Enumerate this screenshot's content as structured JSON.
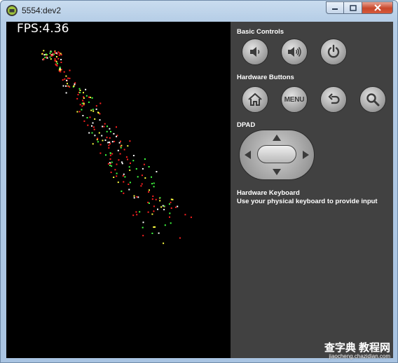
{
  "window": {
    "title": "5554:dev2",
    "minimize_icon": "minimize-icon",
    "maximize_icon": "maximize-icon",
    "close_icon": "close-icon"
  },
  "screen": {
    "fps_text": "FPS:4.36",
    "background": "#000000"
  },
  "controls": {
    "basic_controls_label": "Basic Controls",
    "volume_down_icon": "volume-down-icon",
    "volume_up_icon": "volume-up-icon",
    "power_icon": "power-icon",
    "hardware_buttons_label": "Hardware Buttons",
    "home_icon": "home-icon",
    "menu_label": "MENU",
    "back_icon": "back-icon",
    "search_icon": "search-icon",
    "dpad_label": "DPAD",
    "keyboard_title": "Hardware Keyboard",
    "keyboard_hint": "Use your physical keyboard to provide input"
  },
  "watermark": {
    "main": "查字典 教程网",
    "sub": "jiaocheng.chazidian.com"
  },
  "colors": {
    "panel": "#414141",
    "particle_red": "#ff2020",
    "particle_yellow": "#ffff40",
    "particle_green": "#40ff40",
    "particle_white": "#ffffff"
  }
}
